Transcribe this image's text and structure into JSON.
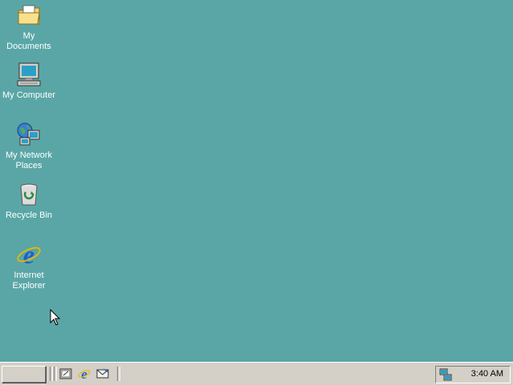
{
  "desktop": {
    "background_color": "#5aa6a6",
    "icons": [
      {
        "label": "My Documents",
        "icon": "folder-documents-icon"
      },
      {
        "label": "My Computer",
        "icon": "computer-icon"
      },
      {
        "label": "My Network Places",
        "icon": "network-places-icon"
      },
      {
        "label": "Recycle Bin",
        "icon": "recycle-bin-icon"
      },
      {
        "label": "Internet Explorer",
        "icon": "internet-explorer-icon"
      }
    ]
  },
  "taskbar": {
    "start_label": "",
    "quick_launch": [
      {
        "icon": "show-desktop-icon"
      },
      {
        "icon": "internet-explorer-icon"
      },
      {
        "icon": "outlook-express-icon"
      }
    ],
    "tray": {
      "icons": [
        "network-tray-icon"
      ],
      "clock": "3:40 AM"
    }
  }
}
